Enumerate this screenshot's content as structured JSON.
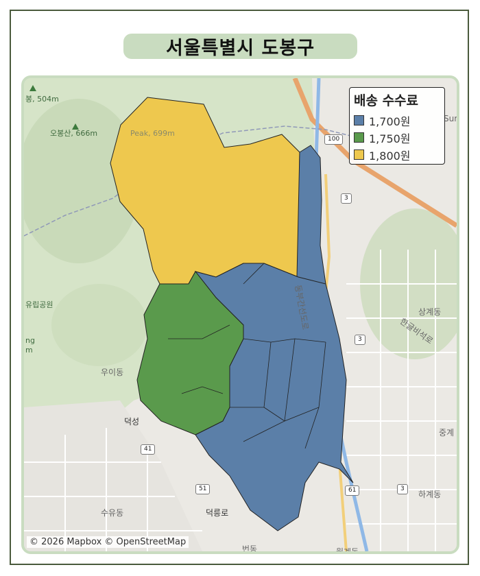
{
  "title": "서울특별시 도봉구",
  "legend": {
    "title": "배송 수수료",
    "items": [
      {
        "label": "1,700원",
        "color": "#5b7fa8"
      },
      {
        "label": "1,750원",
        "color": "#5a9a4c"
      },
      {
        "label": "1,800원",
        "color": "#eec84e"
      }
    ]
  },
  "attribution": "© 2026 Mapbox © OpenStreetMap",
  "map_labels": {
    "peak_504": "봉, 504m",
    "peak_666": "오봉산, 666m",
    "peak_699": "Peak, 699m",
    "park": "유립공원",
    "uidong": "우이동",
    "sanggye": "상계동",
    "hangeul": "한글비석로",
    "junggye": "중계",
    "hagye": "하계동",
    "suyu": "수유동",
    "deokreung": "덕릉로",
    "beondong": "번동",
    "wolgye": "월계동",
    "dongbu": "동부간선도로",
    "deokseong": "덕성",
    "sur": "Sur",
    "ng": "ng",
    "m": "m"
  },
  "shields": [
    "100",
    "3",
    "3",
    "41",
    "51",
    "61",
    "3"
  ],
  "districts": [
    {
      "name": "district-a",
      "fee": "1,800원"
    },
    {
      "name": "district-b",
      "fee": "1,700원"
    },
    {
      "name": "district-c",
      "fee": "1,750원"
    }
  ]
}
